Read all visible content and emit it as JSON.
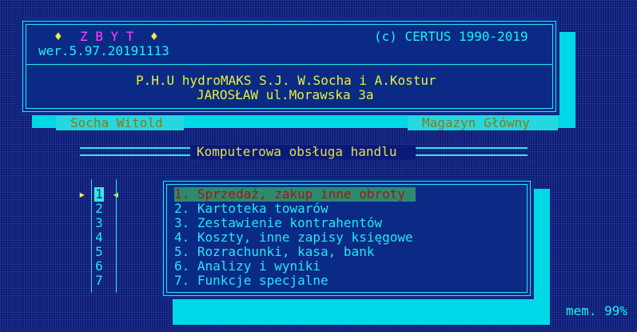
{
  "header": {
    "marker_left": "♦",
    "marker_right": "♦",
    "app_name": "Z B Y T",
    "copyright": "(c) CERTUS 1990-2019",
    "version": "wer.5.97.20191113",
    "company_line1": "P.H.U hydroMAKS S.J. W.Socha i A.Kostur",
    "company_line2": "JAROSŁAW ul.Morawska 3a"
  },
  "status": {
    "user": "Socha Witold",
    "warehouse": "Magazyn Główny"
  },
  "banner": "Komputerowa obsługa handlu",
  "selector": {
    "left_arrow": "▸",
    "right_arrow": "◂",
    "numbers": [
      "1",
      "2",
      "3",
      "4",
      "5",
      "6",
      "7"
    ],
    "selected": 1
  },
  "menu": {
    "items": [
      "1. Sprzedaż, zakup inne obroty",
      "2. Kartoteka towarów",
      "3. Zestawienie kontrahentów",
      "4. Koszty, inne zapisy księgowe",
      "5. Rozrachunki, kasa, bank",
      "6. Analizy i wyniki",
      "7. Funkcje specjalne"
    ]
  },
  "footer": {
    "memory": "mem. 99%"
  }
}
